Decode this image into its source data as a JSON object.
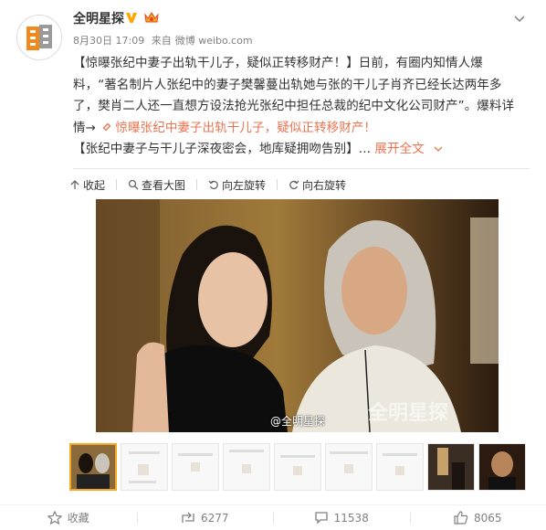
{
  "post": {
    "username": "全明星探",
    "time": "8月30日 17:09",
    "via": "来自",
    "source": "微博 weibo.com",
    "content_lines": [
      "【惊曝张纪中妻子出轨干儿子，疑似正转移财产！】日前，有圈内知情人爆",
      "料，“著名制片人张纪中的妻子樊馨蔓出轨她与张的干儿子肖齐已经长达两年多",
      "了，樊肖二人还一直想方设法抢光张纪中担任总裁的纪中文化公司财产”。爆料详"
    ],
    "line4_prefix": "情→",
    "link_text": "惊曝张纪中妻子出轨干儿子，疑似正转移财产！",
    "line5_text": "【张纪中妻子与干儿子深夜密会，地库疑拥吻告别】...",
    "expand_label": "展开全文"
  },
  "toolbar": {
    "collapse": "收起",
    "view_large": "查看大图",
    "rotate_left": "向左旋转",
    "rotate_right": "向右旋转"
  },
  "image": {
    "watermark": "全明星探",
    "credit": "@全明星探"
  },
  "thumbnails": {
    "count": 9,
    "selected_index": 0
  },
  "actions": {
    "favorite": "收藏",
    "repost": "6277",
    "comment": "11538",
    "like": "8065"
  },
  "colors": {
    "accent": "#eb7350",
    "verified": "#ffa500"
  }
}
